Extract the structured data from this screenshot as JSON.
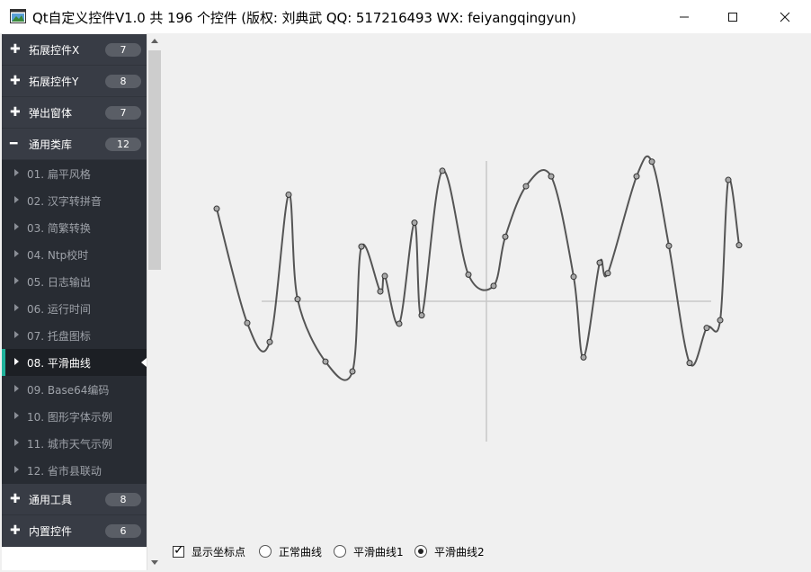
{
  "window": {
    "title": "Qt自定义控件V1.0 共 196 个控件 (版权: 刘典武 QQ: 517216493 WX: feiyangqingyun)",
    "icon": "app-window-icon"
  },
  "sidebar": {
    "groups_top": [
      {
        "label": "拓展控件X",
        "count": "7",
        "icon": "plus-icon"
      },
      {
        "label": "拓展控件Y",
        "count": "8",
        "icon": "plus-icon"
      },
      {
        "label": "弹出窗体",
        "count": "7",
        "icon": "plus-icon"
      },
      {
        "label": "通用类库",
        "count": "12",
        "icon": "minus-icon"
      }
    ],
    "items": [
      {
        "label": "01. 扁平风格"
      },
      {
        "label": "02. 汉字转拼音"
      },
      {
        "label": "03. 简繁转换"
      },
      {
        "label": "04. Ntp校时"
      },
      {
        "label": "05. 日志输出"
      },
      {
        "label": "06. 运行时间"
      },
      {
        "label": "07. 托盘图标"
      },
      {
        "label": "08. 平滑曲线",
        "selected": true
      },
      {
        "label": "09. Base64编码"
      },
      {
        "label": "10. 图形字体示例"
      },
      {
        "label": "11. 城市天气示例"
      },
      {
        "label": "12. 省市县联动"
      }
    ],
    "groups_bottom": [
      {
        "label": "通用工具",
        "count": "8",
        "icon": "plus-icon"
      },
      {
        "label": "内置控件",
        "count": "6",
        "icon": "plus-icon"
      }
    ],
    "accent_color": "#20b29b"
  },
  "controls": {
    "show_points_label": "显示坐标点",
    "show_points_checked": true,
    "normal_curve_label": "正常曲线",
    "smooth1_label": "平滑曲线1",
    "smooth2_label": "平滑曲线2",
    "selected_mode": "平滑曲线2"
  },
  "chart_data": {
    "type": "line",
    "style": "smooth curve with point markers",
    "axes_crosshair": true,
    "xlim": [
      -250,
      250
    ],
    "ylim": [
      -200,
      200
    ],
    "points": [
      [
        -300,
        132
      ],
      [
        -266,
        -31
      ],
      [
        -241,
        -58
      ],
      [
        -220,
        152
      ],
      [
        -210,
        3
      ],
      [
        -179,
        -86
      ],
      [
        -149,
        -100
      ],
      [
        -139,
        78
      ],
      [
        -118,
        14
      ],
      [
        -113,
        36
      ],
      [
        -97,
        -32
      ],
      [
        -80,
        112
      ],
      [
        -72,
        -20
      ],
      [
        -49,
        186
      ],
      [
        -20,
        38
      ],
      [
        8,
        22
      ],
      [
        21,
        92
      ],
      [
        44,
        164
      ],
      [
        72,
        178
      ],
      [
        97,
        35
      ],
      [
        108,
        -80
      ],
      [
        126,
        55
      ],
      [
        135,
        40
      ],
      [
        167,
        178
      ],
      [
        184,
        199
      ],
      [
        203,
        79
      ],
      [
        226,
        -88
      ],
      [
        245,
        -38
      ],
      [
        260,
        -27
      ],
      [
        269,
        173
      ],
      [
        281,
        80
      ]
    ],
    "line_color": "#555555",
    "point_fill": "#a9a9a9",
    "axis_color": "#c8c8c8"
  }
}
